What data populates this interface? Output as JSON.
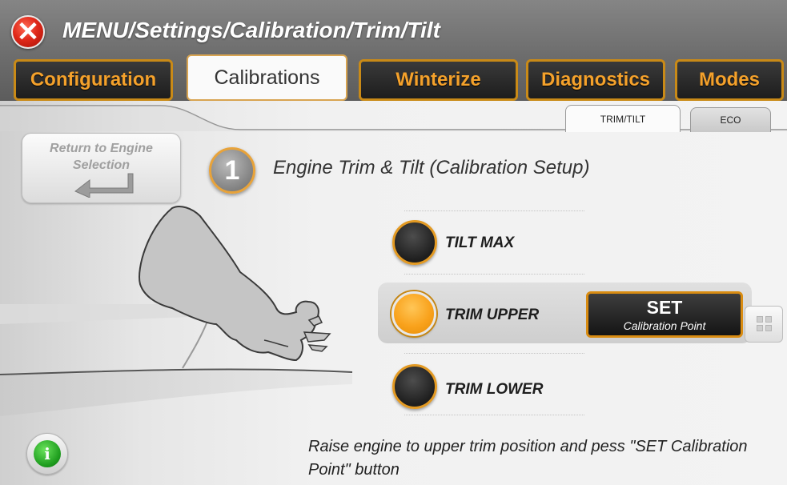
{
  "header": {
    "breadcrumb": "MENU/Settings/Calibration/Trim/Tilt",
    "close_icon": "close-icon",
    "close_color": "#e0291a"
  },
  "tabs": [
    {
      "label": "Configuration",
      "active": false
    },
    {
      "label": "Calibrations",
      "active": true
    },
    {
      "label": "Winterize",
      "active": false
    },
    {
      "label": "Diagnostics",
      "active": false
    },
    {
      "label": "Modes",
      "active": false
    }
  ],
  "subtabs": [
    {
      "label": "TRIM/TILT",
      "active": true
    },
    {
      "label": "ECO",
      "active": false
    }
  ],
  "return_button": {
    "label": "Return to Engine Selection",
    "icon": "return-arrow-icon"
  },
  "step": {
    "number": "1",
    "title": "Engine Trim & Tilt (Calibration Setup)"
  },
  "options": [
    {
      "label": "TILT MAX",
      "selected": false
    },
    {
      "label": "TRIM UPPER",
      "selected": true
    },
    {
      "label": "TRIM LOWER",
      "selected": false
    }
  ],
  "set_button": {
    "title": "SET",
    "subtitle": "Calibration Point"
  },
  "grid_button": {
    "icon": "grid-icon"
  },
  "info_button": {
    "icon": "info-icon",
    "glyph": "i"
  },
  "instruction": "Raise engine to upper trim position and pess \"SET Calibration Point\" button",
  "colors": {
    "accent": "#f4a12b",
    "tab_border": "#c98a17",
    "header_bg": "#6d6d6d"
  }
}
